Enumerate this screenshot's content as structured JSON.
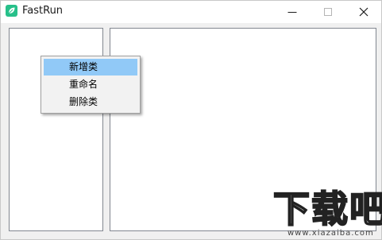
{
  "window": {
    "title": "FastRun",
    "icon": "leaf-icon",
    "controls": [
      "minimize-icon",
      "maximize-icon",
      "close-icon"
    ]
  },
  "context_menu": {
    "items": [
      {
        "label": "新增类",
        "highlighted": true
      },
      {
        "label": "重命名",
        "highlighted": false
      },
      {
        "label": "删除类",
        "highlighted": false
      }
    ]
  },
  "watermark": {
    "big": "下载吧",
    "small": "www.xiazaiba.com"
  },
  "colors": {
    "accent": "#27c08a",
    "menu_highlight": "#91c9f7"
  }
}
